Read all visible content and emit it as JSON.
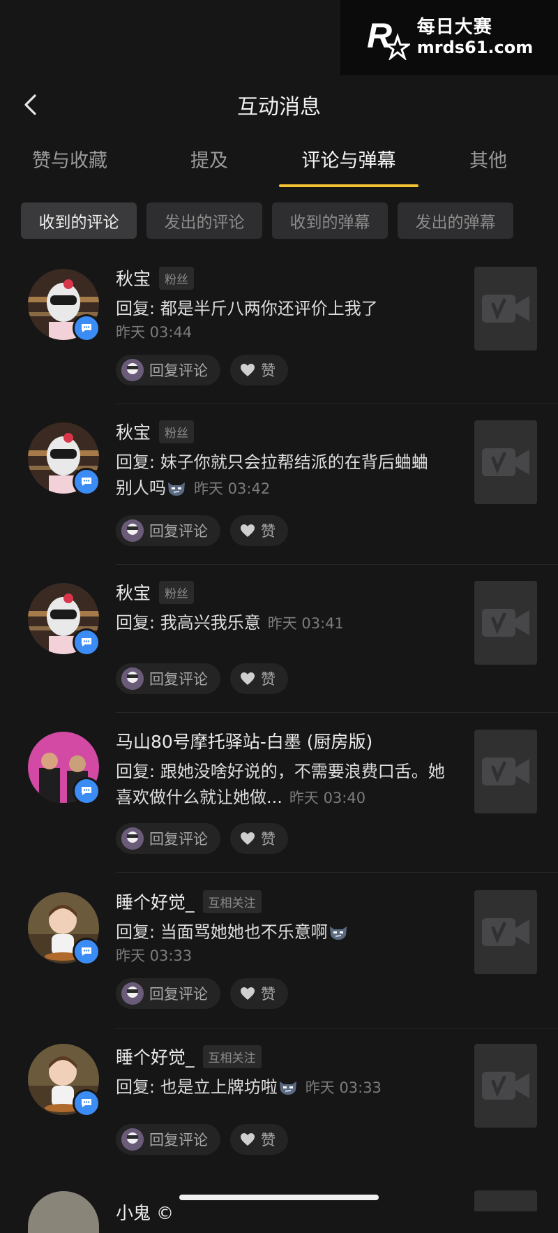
{
  "watermark": {
    "line1": "每日大赛",
    "line2": "mrds61.com",
    "logo_letter": "R",
    "logo_small": "每日大赛"
  },
  "header": {
    "title": "互动消息"
  },
  "tabs": [
    {
      "label": "赞与收藏",
      "active": false
    },
    {
      "label": "提及",
      "active": false
    },
    {
      "label": "评论与弹幕",
      "active": true
    },
    {
      "label": "其他",
      "active": false
    }
  ],
  "filters": [
    {
      "label": "收到的评论",
      "active": true
    },
    {
      "label": "发出的评论",
      "active": false
    },
    {
      "label": "收到的弹幕",
      "active": false
    },
    {
      "label": "发出的弹幕",
      "active": false
    }
  ],
  "actions": {
    "reply_label": "回复评论",
    "like_label": "赞"
  },
  "items": [
    {
      "name": "秋宝",
      "tag": "粉丝",
      "comment": "回复: 都是半斤八两你还评价上我了",
      "emoji": false,
      "time": "昨天 03:44",
      "time_inline": false,
      "avatar": "helmet"
    },
    {
      "name": "秋宝",
      "tag": "粉丝",
      "comment": "回复: 妹子你就只会拉帮结派的在背后蛐蛐别人吗",
      "emoji": true,
      "time": "昨天 03:42",
      "time_inline": true,
      "avatar": "helmet"
    },
    {
      "name": "秋宝",
      "tag": "粉丝",
      "comment": "回复: 我高兴我乐意",
      "emoji": false,
      "time": "昨天 03:41",
      "time_inline": true,
      "avatar": "helmet"
    },
    {
      "name": "马山80号摩托驿站-白墨 (厨房版)",
      "tag": "",
      "comment": "回复: 跟她没啥好说的，不需要浪费口舌。她喜欢做什么就让她做...",
      "emoji": false,
      "time": "昨天 03:40",
      "time_inline": true,
      "avatar": "people"
    },
    {
      "name": "睡个好觉_",
      "tag": "互相关注",
      "comment": "回复: 当面骂她她也不乐意啊",
      "emoji": true,
      "time": "昨天 03:33",
      "time_inline": false,
      "avatar": "child"
    },
    {
      "name": "睡个好觉_",
      "tag": "互相关注",
      "comment": "回复: 也是立上牌坊啦",
      "emoji": true,
      "time": "昨天 03:33",
      "time_inline": true,
      "avatar": "child"
    }
  ],
  "partial_item": {
    "name": "小鬼 ©"
  },
  "colors": {
    "background": "#161617",
    "accent": "#f2c230",
    "badge": "#3b8cf4"
  }
}
